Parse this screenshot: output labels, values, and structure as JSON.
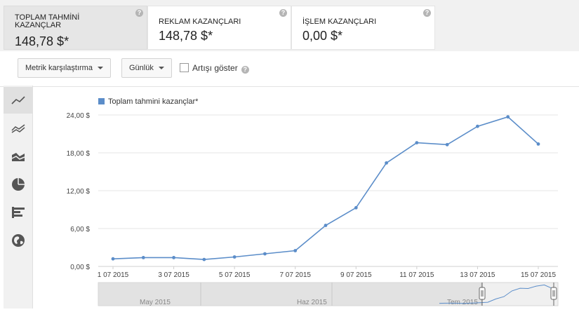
{
  "metrics": [
    {
      "title": "TOPLAM TAHMİNİ KAZANÇLAR",
      "value": "148,78 $*",
      "help": "?"
    },
    {
      "title": "REKLAM KAZANÇLARI",
      "value": "148,78 $*",
      "help": "?"
    },
    {
      "title": "İŞLEM KAZANÇLARI",
      "value": "0,00 $*",
      "help": "?"
    }
  ],
  "toolbar": {
    "compare_label": "Metrik karşılaştırma",
    "period_label": "Günlük",
    "show_increase_label": "Artışı göster",
    "help": "?"
  },
  "sidebar_icons": [
    "line-chart-icon",
    "multi-line-chart-icon",
    "area-chart-icon",
    "pie-chart-icon",
    "bar-chart-icon",
    "globe-icon"
  ],
  "colors": {
    "series": "#5b8dc9",
    "accent_grid": "#e5e5e5"
  },
  "chart_data": {
    "type": "line",
    "series": [
      {
        "name": "Toplam tahmini kazançlar*",
        "values": [
          1.2,
          1.4,
          1.4,
          1.1,
          1.5,
          2.0,
          2.5,
          6.5,
          9.3,
          16.4,
          19.6,
          19.3,
          22.2,
          23.7,
          19.4
        ]
      }
    ],
    "x": [
      "1 07 2015",
      "2 07 2015",
      "3 07 2015",
      "4 07 2015",
      "5 07 2015",
      "6 07 2015",
      "7 07 2015",
      "8 07 2015",
      "9 07 2015",
      "10 07 2015",
      "11 07 2015",
      "12 07 2015",
      "13 07 2015",
      "14 07 2015",
      "15 07 2015"
    ],
    "x_tick_labels": [
      "1 07 2015",
      "3 07 2015",
      "5 07 2015",
      "7 07 2015",
      "9 07 2015",
      "11 07 2015",
      "13 07 2015",
      "15 07 2015"
    ],
    "y_tick_labels": [
      "24,00 $",
      "18,00 $",
      "12,00 $",
      "6,00 $",
      "0,00 $"
    ],
    "ylim": [
      0,
      24
    ],
    "grid": true,
    "legend": "top-left",
    "navigator_labels": [
      "May 2015",
      "Haz 2015",
      "Tem 2015"
    ]
  }
}
